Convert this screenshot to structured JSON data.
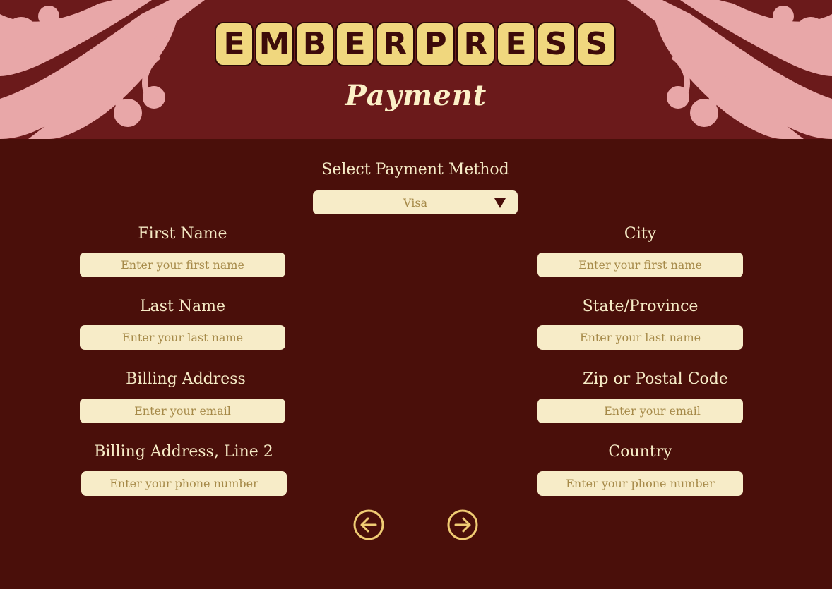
{
  "header": {
    "logo_letters": [
      "E",
      "M",
      "B",
      "E",
      "R",
      "P",
      "R",
      "E",
      "S",
      "S"
    ],
    "title": "Payment"
  },
  "payment_method": {
    "label": "Select Payment Method",
    "selected": "Visa"
  },
  "left_column": [
    {
      "label": "First Name",
      "placeholder": "Enter your first name"
    },
    {
      "label": "Last Name",
      "placeholder": "Enter your last name"
    },
    {
      "label": "Billing Address",
      "placeholder": "Enter your email"
    },
    {
      "label": "Billing Address, Line 2",
      "placeholder": "Enter your phone number"
    }
  ],
  "right_column": [
    {
      "label": "City",
      "placeholder": "Enter your first name"
    },
    {
      "label": "State/Province",
      "placeholder": "Enter your last name"
    },
    {
      "label": "Zip or Postal Code",
      "placeholder": "Enter your email"
    },
    {
      "label": "Country",
      "placeholder": "Enter your phone number"
    }
  ],
  "navigation": {
    "back_icon": "arrow-left-circle-icon",
    "next_icon": "arrow-right-circle-icon"
  },
  "colors": {
    "background": "#4a0f0a",
    "header_background": "#6b1a1b",
    "flourish": "#e8a7a8",
    "logo_tile": "#f0d77e",
    "field_background": "#f7ecc8",
    "placeholder_text": "#a68a49",
    "label_text": "#f6ebc6",
    "nav_icon": "#f0cc74"
  }
}
